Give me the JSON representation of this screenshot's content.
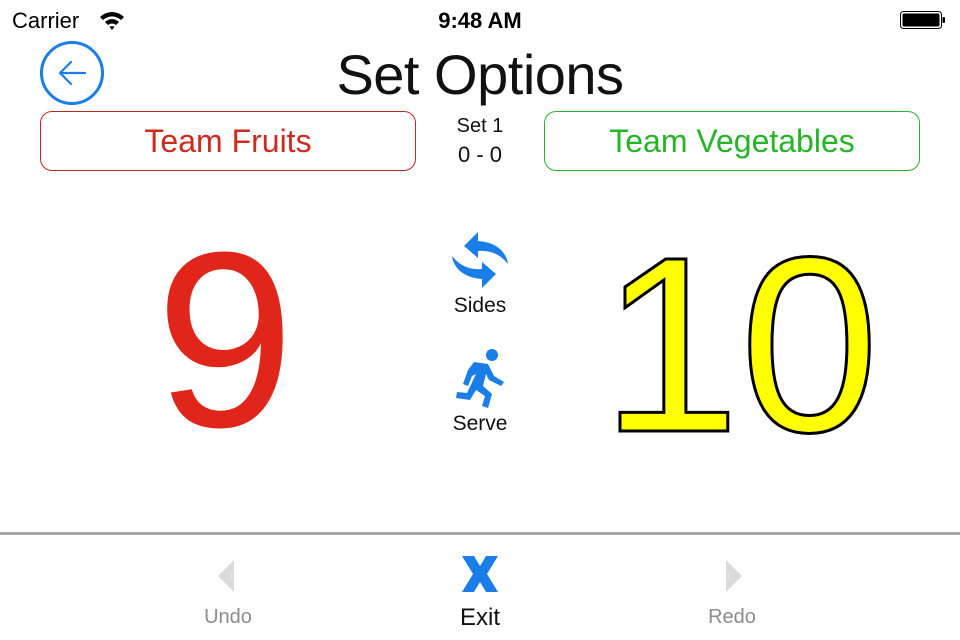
{
  "status_bar": {
    "carrier": "Carrier",
    "time": "9:48 AM",
    "wifi_icon": "wifi-icon",
    "battery_icon": "battery-full-icon"
  },
  "header": {
    "title": "Set Options",
    "back_icon": "arrow-left-circle-icon"
  },
  "teams": {
    "left": {
      "name": "Team Fruits",
      "color": "#d0291d",
      "score": "9"
    },
    "right": {
      "name": "Team Vegetables",
      "color": "#26b526",
      "score": "10",
      "score_color": "#ffff00"
    }
  },
  "set_info": {
    "label": "Set 1",
    "score": "0 - 0"
  },
  "controls": {
    "sides": {
      "label": "Sides",
      "icon": "swap-arrows-icon"
    },
    "serve": {
      "label": "Serve",
      "icon": "running-person-icon"
    }
  },
  "toolbar": {
    "undo": {
      "label": "Undo",
      "icon": "triangle-left-icon",
      "enabled": false
    },
    "exit": {
      "label": "Exit",
      "icon": "x-icon",
      "enabled": true
    },
    "redo": {
      "label": "Redo",
      "icon": "triangle-right-icon",
      "enabled": false
    }
  },
  "colors": {
    "accent": "#1a7ee8",
    "disabled": "#dcdcdc"
  }
}
